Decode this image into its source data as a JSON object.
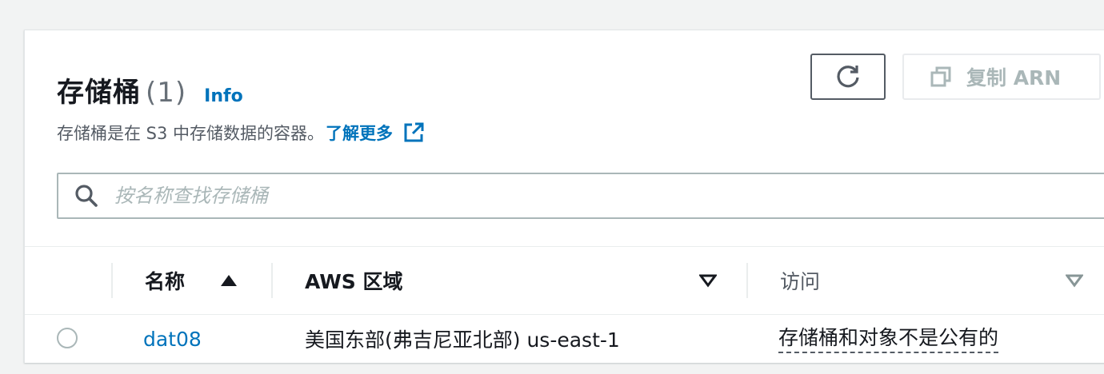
{
  "header": {
    "title": "存储桶",
    "count": "(1)",
    "info_link": "Info",
    "description": "存储桶是在 S3 中存储数据的容器。",
    "learn_more": "了解更多"
  },
  "toolbar": {
    "copy_arn_label": "复制 ARN"
  },
  "search": {
    "placeholder": "按名称查找存储桶",
    "value": ""
  },
  "table": {
    "columns": {
      "name": "名称",
      "region": "AWS 区域",
      "access": "访问"
    },
    "rows": [
      {
        "name": "dat08",
        "region": "美国东部(弗吉尼亚北部) us-east-1",
        "access": "存储桶和对象不是公有的"
      }
    ]
  },
  "colors": {
    "link": "#0073bb",
    "text": "#16191f",
    "muted": "#545b64",
    "disabled": "#aab7b8"
  }
}
